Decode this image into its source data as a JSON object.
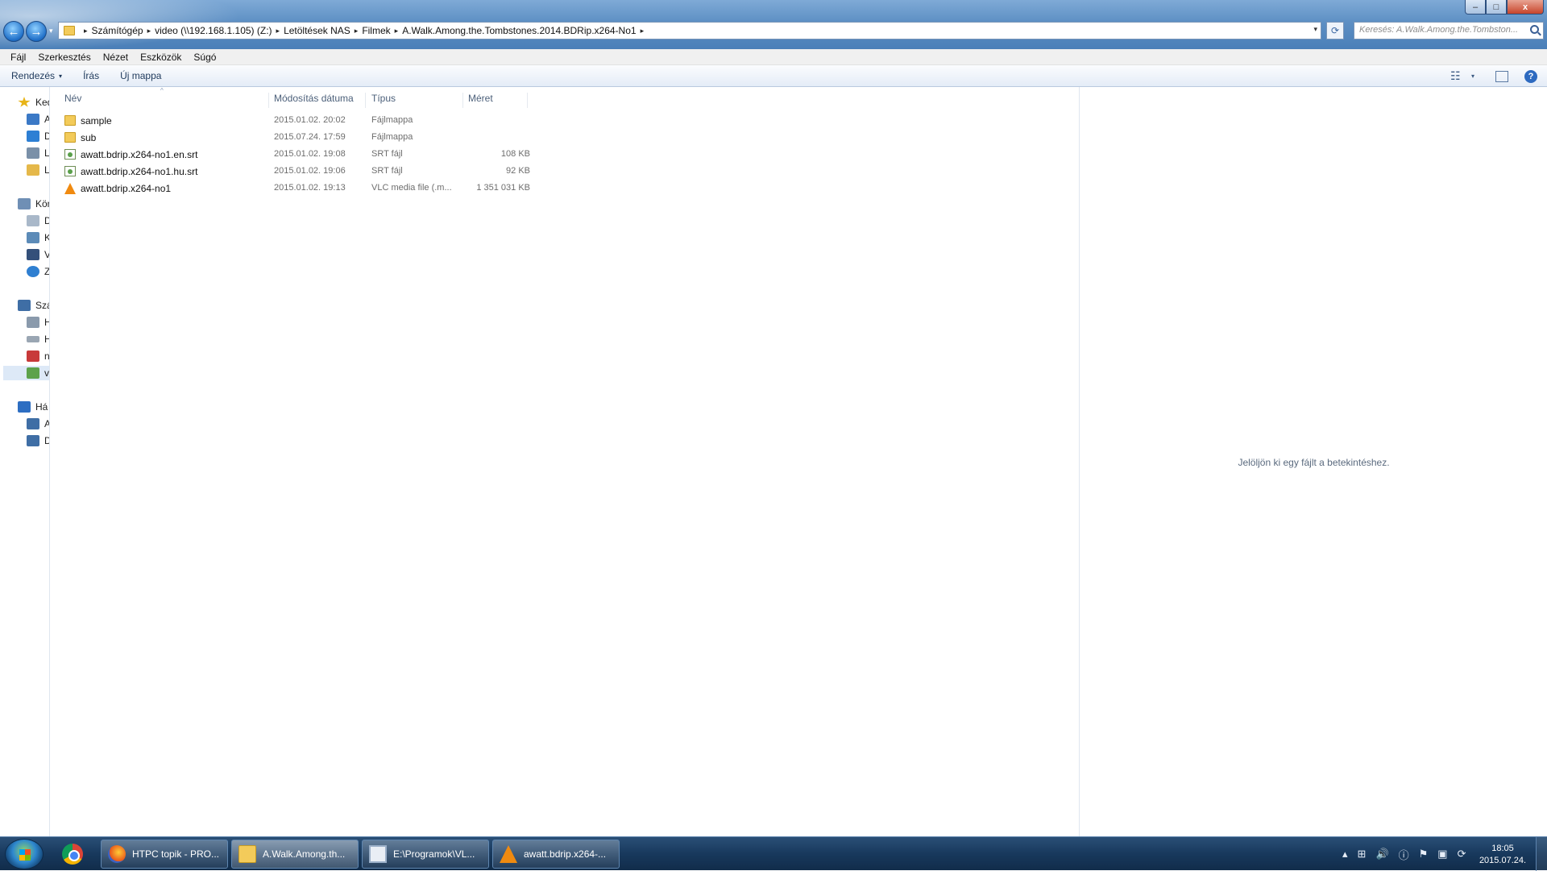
{
  "window": {
    "minimize_label": "–",
    "maximize_label": "□",
    "close_label": "x"
  },
  "nav": {
    "back_glyph": "←",
    "forward_glyph": "→",
    "history_glyph": "▾"
  },
  "address": {
    "crumbs": [
      "Számítógép",
      "video (\\\\192.168.1.105) (Z:)",
      "Letöltések NAS",
      "Filmek",
      "A.Walk.Among.the.Tombstones.2014.BDRip.x264-No1"
    ],
    "arrow_glyph": "▸",
    "dropdown_glyph": "▾",
    "refresh_glyph": "⟳"
  },
  "search": {
    "placeholder": "Keresés: A.Walk.Among.the.Tombston..."
  },
  "menu": [
    "Fájl",
    "Szerkesztés",
    "Nézet",
    "Eszközök",
    "Súgó"
  ],
  "commands": {
    "organize": "Rendezés",
    "caret": "▾",
    "burn": "Írás",
    "new_folder": "Új mappa",
    "view_glyph": "☷",
    "view_caret": "▾",
    "help_glyph": "?"
  },
  "navpane": {
    "items": [
      {
        "label": "Ked",
        "icon": "star-icon",
        "color": "#e8b417",
        "top": 0
      },
      {
        "label": "A",
        "icon": "desktop-icon",
        "color": "#3b79c6"
      },
      {
        "label": "D",
        "icon": "dropbox-icon",
        "color": "#2d7fd4"
      },
      {
        "label": "L",
        "icon": "recent-places-icon",
        "color": "#7a90a8"
      },
      {
        "label": "L",
        "icon": "downloads-icon",
        "color": "#e5b84a"
      },
      {
        "label": "Kön",
        "icon": "libraries-icon",
        "color": "#6f8fb5"
      },
      {
        "label": "D",
        "icon": "documents-icon",
        "color": "#a9b8c9"
      },
      {
        "label": "K",
        "icon": "pictures-icon",
        "color": "#5c8bb8"
      },
      {
        "label": "V",
        "icon": "videos-icon",
        "color": "#34507a"
      },
      {
        "label": "Z",
        "icon": "music-icon",
        "color": "#2f7fd1"
      },
      {
        "label": "Szá",
        "icon": "computer-icon",
        "color": "#3f6ea5"
      },
      {
        "label": "H",
        "icon": "local-disk-icon",
        "color": "#8a9aac"
      },
      {
        "label": "H",
        "icon": "drive-icon",
        "color": "#9aa6b3"
      },
      {
        "label": "n",
        "icon": "disconnected-drive-icon",
        "color": "#c83a3a"
      },
      {
        "label": "v",
        "icon": "network-drive-icon",
        "color": "#5da24b"
      },
      {
        "label": "Há",
        "icon": "network-icon",
        "color": "#2d6ec2"
      },
      {
        "label": "A",
        "icon": "network-computer-icon",
        "color": "#3f6ea5"
      },
      {
        "label": "D",
        "icon": "network-computer-icon",
        "color": "#3f6ea5"
      }
    ]
  },
  "filelist": {
    "sort_glyph": "^",
    "columns": {
      "name": "Név",
      "date": "Módosítás dátuma",
      "type": "Típus",
      "size": "Méret"
    },
    "rows": [
      {
        "name": "sample",
        "date": "2015.01.02. 20:02",
        "type": "Fájlmappa",
        "size": "",
        "icon": "folder-icon"
      },
      {
        "name": "sub",
        "date": "2015.07.24. 17:59",
        "type": "Fájlmappa",
        "size": "",
        "icon": "folder-icon"
      },
      {
        "name": "awatt.bdrip.x264-no1.en.srt",
        "date": "2015.01.02. 19:08",
        "type": "SRT fájl",
        "size": "108 KB",
        "icon": "srt-file-icon"
      },
      {
        "name": "awatt.bdrip.x264-no1.hu.srt",
        "date": "2015.01.02. 19:06",
        "type": "SRT fájl",
        "size": "92 KB",
        "icon": "srt-file-icon"
      },
      {
        "name": "awatt.bdrip.x264-no1",
        "date": "2015.01.02. 19:13",
        "type": "VLC media file (.m...",
        "size": "1 351 031 KB",
        "icon": "vlc-file-icon"
      }
    ]
  },
  "preview": {
    "message": "Jelöljön ki egy fájlt a betekintéshez."
  },
  "taskbar": {
    "buttons": [
      {
        "label": "HTPC topik - PRO...",
        "icon": "firefox-icon"
      },
      {
        "label": "A.Walk.Among.th...",
        "icon": "explorer-icon"
      },
      {
        "label": "E:\\Programok\\VL...",
        "icon": "window-icon"
      },
      {
        "label": "awatt.bdrip.x264-...",
        "icon": "vlc-icon"
      }
    ],
    "tray": {
      "show_hidden_glyph": "▴",
      "windows_glyph": "⊞",
      "volume_glyph": "🔊",
      "info_glyph": "ⓘ",
      "flag_glyph": "⚑",
      "network_glyph": "▣",
      "sync_glyph": "⟳"
    },
    "clock": {
      "time": "18:05",
      "date": "2015.07.24."
    }
  }
}
